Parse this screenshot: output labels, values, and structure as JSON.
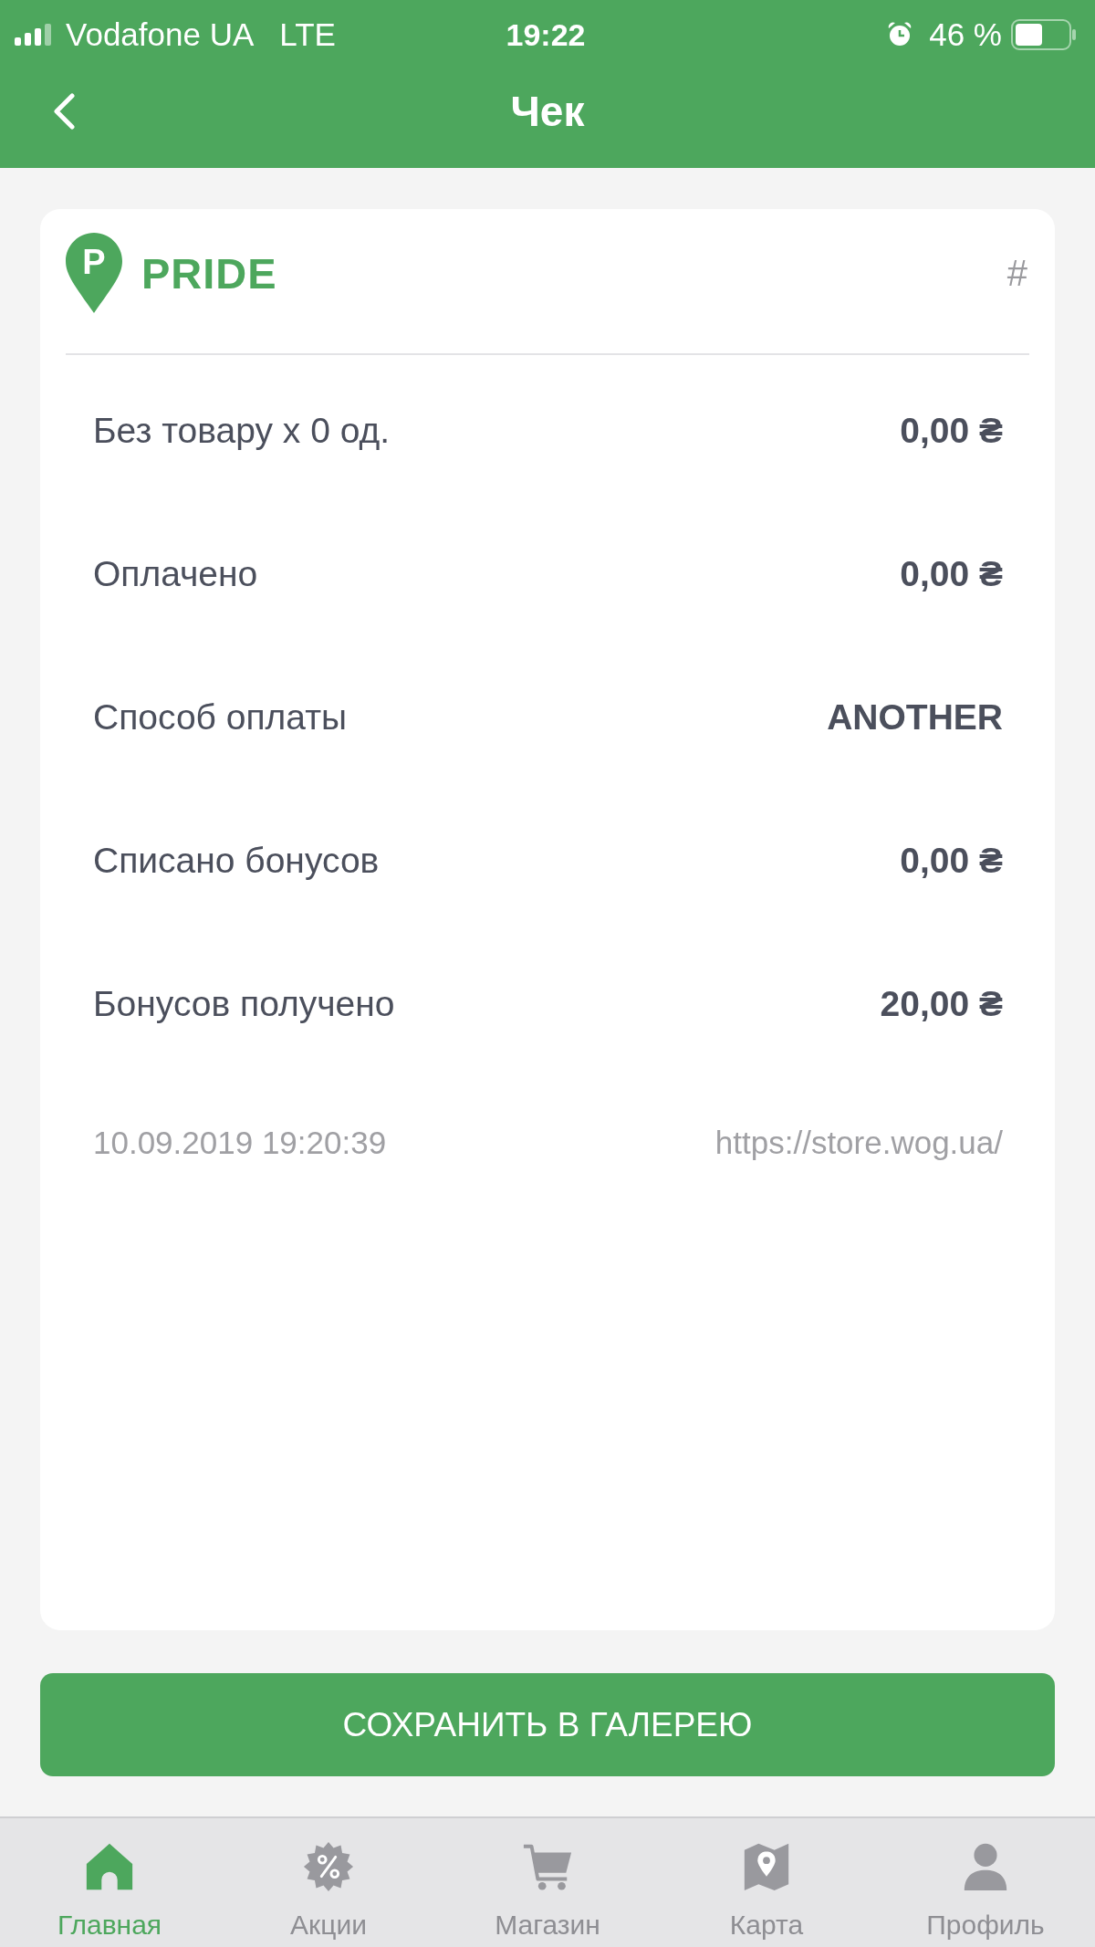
{
  "status_bar": {
    "carrier": "Vodafone UA",
    "network": "LTE",
    "time": "19:22",
    "battery_percent": "46 %"
  },
  "header": {
    "title": "Чек"
  },
  "receipt": {
    "logo_letter": "P",
    "brand": "PRIDE",
    "number_sign": "#",
    "rows": [
      {
        "label": "Без товару x 0 од.",
        "value": "0,00 ₴"
      },
      {
        "label": "Оплачено",
        "value": "0,00 ₴"
      },
      {
        "label": "Способ оплаты",
        "value": "ANOTHER"
      },
      {
        "label": "Списано бонусов",
        "value": "0,00 ₴"
      },
      {
        "label": "Бонусов получено",
        "value": "20,00 ₴"
      }
    ],
    "date": "10.09.2019 19:20:39",
    "url": "https://store.wog.ua/"
  },
  "save_button": {
    "label": "СОХРАНИТЬ В ГАЛЕРЕЮ"
  },
  "tab_bar": {
    "tabs": [
      {
        "label": "Главная",
        "selected": true
      },
      {
        "label": "Акции",
        "selected": false
      },
      {
        "label": "Магазин",
        "selected": false
      },
      {
        "label": "Карта",
        "selected": false
      },
      {
        "label": "Профиль",
        "selected": false
      }
    ]
  }
}
